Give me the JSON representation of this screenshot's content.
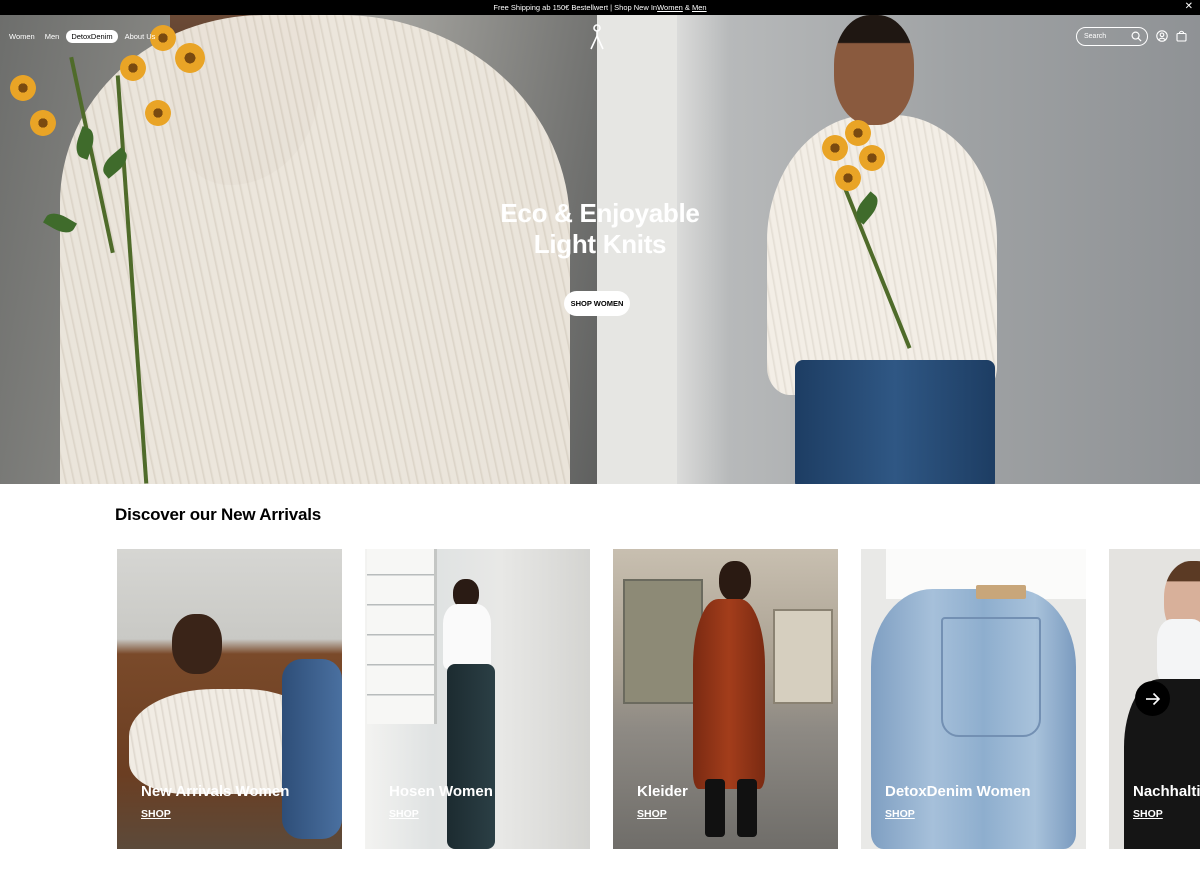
{
  "announcement": {
    "text_prefix": "Free Shipping ab 150€ Bestellwert | Shop New In ",
    "link_women": "Women",
    "amp": " & ",
    "link_men": "Men",
    "close": "✕"
  },
  "nav": {
    "items": [
      {
        "label": "Women",
        "active": false
      },
      {
        "label": "Men",
        "active": false
      },
      {
        "label": "DetoxDenim",
        "active": true
      },
      {
        "label": "About Us",
        "active": false
      }
    ],
    "search_placeholder": "Search"
  },
  "hero": {
    "title_line1": "Eco & Enjoyable",
    "title_line2": "Light Knits",
    "button_label": "SHOP WOMEN"
  },
  "arrivals": {
    "title": "Discover our New Arrivals",
    "cards": [
      {
        "title": "New Arrivals Women",
        "cta": "SHOP"
      },
      {
        "title": "Hosen Women",
        "cta": "SHOP"
      },
      {
        "title": "Kleider",
        "cta": "SHOP"
      },
      {
        "title": "DetoxDenim Women",
        "cta": "SHOP"
      },
      {
        "title": "Nachhalti",
        "cta": "SHOP"
      }
    ]
  },
  "colors": {
    "announcement_bg": "#000000",
    "accent": "#000000",
    "text_on_image": "#ffffff"
  },
  "icons": [
    "close-icon",
    "logo-icon",
    "search-icon",
    "user-icon",
    "bag-icon",
    "arrow-right-icon"
  ]
}
